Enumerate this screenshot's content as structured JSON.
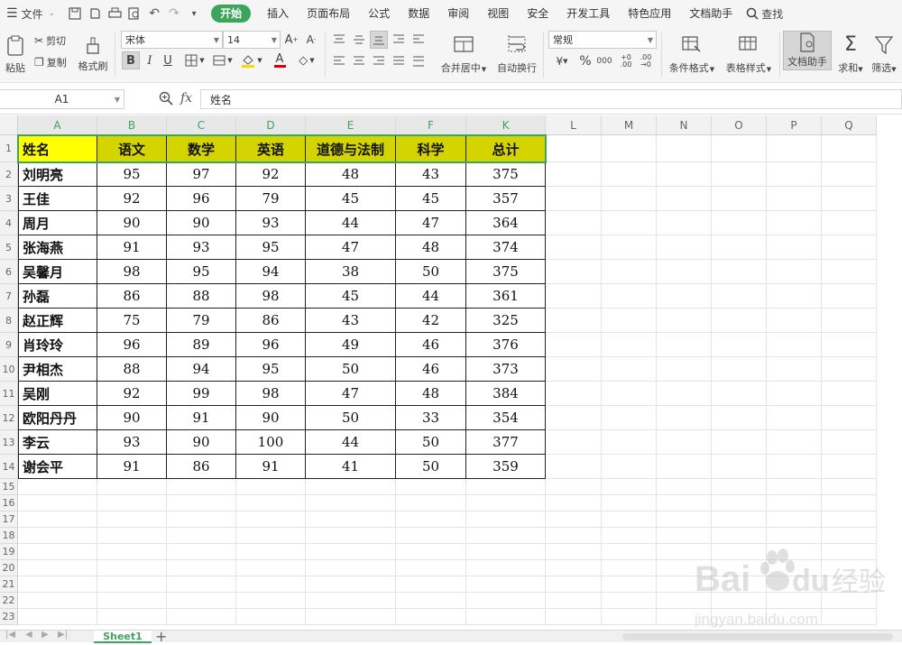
{
  "menubar": {
    "file_label": "文件",
    "tabs": [
      "开始",
      "插入",
      "页面布局",
      "公式",
      "数据",
      "审阅",
      "视图",
      "安全",
      "开发工具",
      "特色应用",
      "文档助手"
    ],
    "active_tab": "开始",
    "search_label": "查找"
  },
  "ribbon": {
    "paste_label": "粘贴",
    "cut_label": "剪切",
    "copy_label": "复制",
    "format_painter_label": "格式刷",
    "font_name": "宋体",
    "font_size": "14",
    "merge_label": "合并居中",
    "wrap_label": "自动换行",
    "number_format": "常规",
    "conditional_label": "条件格式",
    "table_style_label": "表格样式",
    "doc_assistant_label": "文档助手",
    "sum_label": "求和",
    "filter_label": "筛选"
  },
  "formula_bar": {
    "cell_ref": "A1",
    "fx": "fx",
    "content": "姓名"
  },
  "columns": [
    "A",
    "B",
    "C",
    "D",
    "E",
    "F",
    "K",
    "L",
    "M",
    "N",
    "O",
    "P",
    "Q"
  ],
  "row_numbers": [
    "1",
    "2",
    "3",
    "4",
    "5",
    "6",
    "7",
    "8",
    "9",
    "10",
    "11",
    "12",
    "13",
    "14",
    "15",
    "16",
    "17",
    "18",
    "19",
    "20",
    "21",
    "22",
    "23"
  ],
  "table": {
    "header": [
      "姓名",
      "语文",
      "数学",
      "英语",
      "道德与法制",
      "科学",
      "总计"
    ],
    "rows": [
      [
        "刘明亮",
        "95",
        "97",
        "92",
        "48",
        "43",
        "375"
      ],
      [
        "王佳",
        "92",
        "96",
        "79",
        "45",
        "45",
        "357"
      ],
      [
        "周月",
        "90",
        "90",
        "93",
        "44",
        "47",
        "364"
      ],
      [
        "张海燕",
        "91",
        "93",
        "95",
        "47",
        "48",
        "374"
      ],
      [
        "吴馨月",
        "98",
        "95",
        "94",
        "38",
        "50",
        "375"
      ],
      [
        "孙磊",
        "86",
        "88",
        "98",
        "45",
        "44",
        "361"
      ],
      [
        "赵正辉",
        "75",
        "79",
        "86",
        "43",
        "42",
        "325"
      ],
      [
        "肖玲玲",
        "96",
        "89",
        "96",
        "49",
        "46",
        "376"
      ],
      [
        "尹相杰",
        "88",
        "94",
        "95",
        "50",
        "46",
        "373"
      ],
      [
        "吴刚",
        "92",
        "99",
        "98",
        "47",
        "48",
        "384"
      ],
      [
        "欧阳丹丹",
        "90",
        "91",
        "90",
        "50",
        "33",
        "354"
      ],
      [
        "李云",
        "93",
        "90",
        "100",
        "44",
        "50",
        "377"
      ],
      [
        "谢会平",
        "91",
        "86",
        "91",
        "41",
        "50",
        "359"
      ]
    ]
  },
  "sheet_tab": "Sheet1",
  "colors": {
    "accent": "#3ba55c",
    "header_fill": "#d4d400",
    "name_header_fill": "#ffff00"
  },
  "watermark": {
    "brand": "Bai",
    "brand2": "du",
    "cn": "经验",
    "url": "jingyan.baidu.com"
  }
}
